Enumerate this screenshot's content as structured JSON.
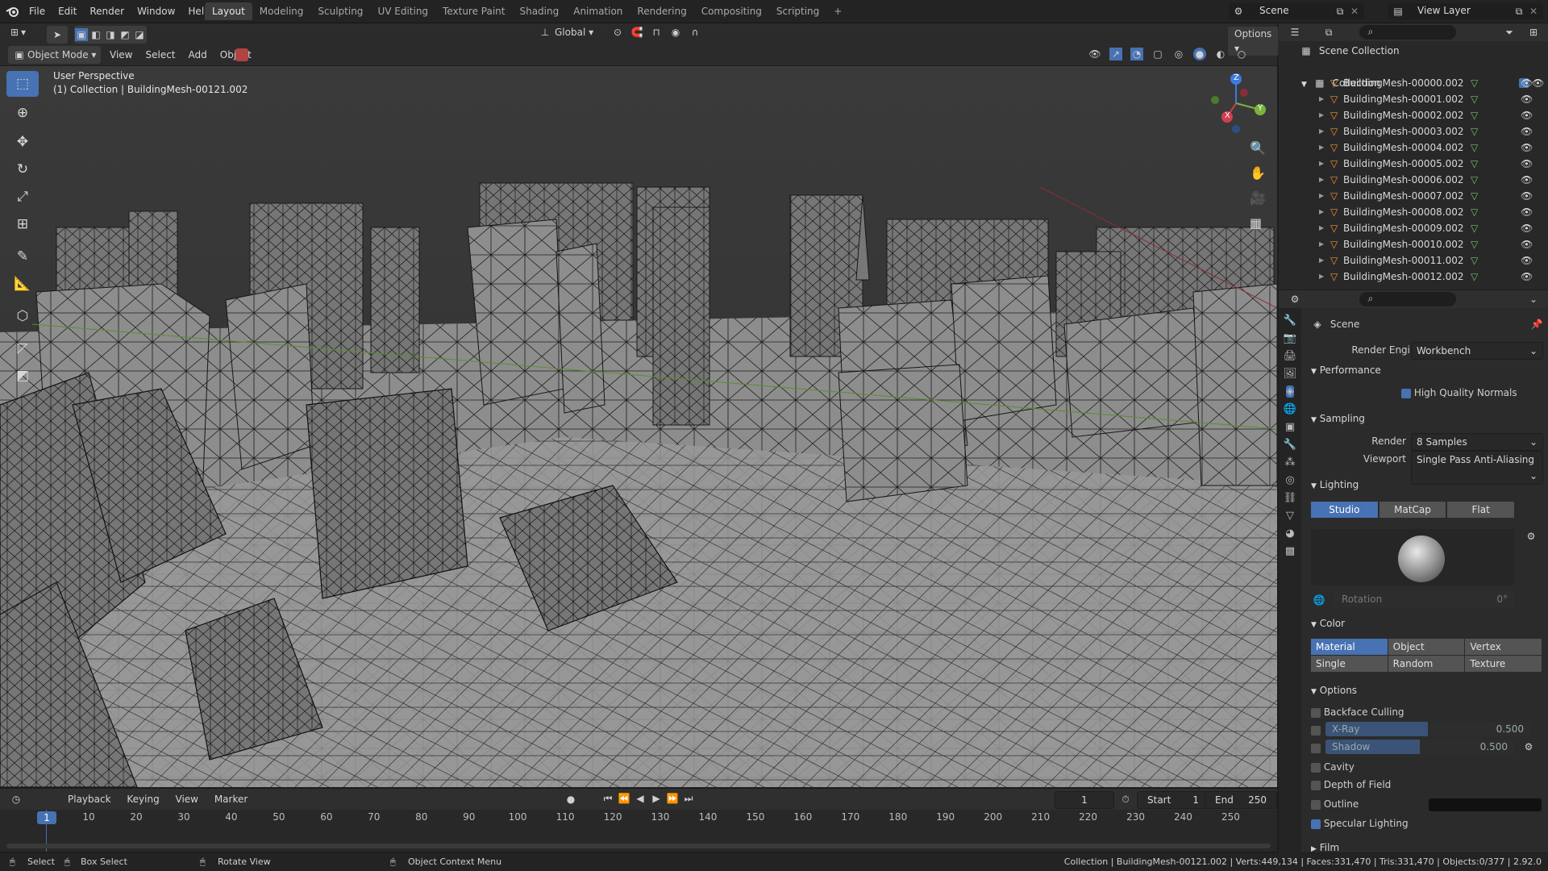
{
  "topbar": {
    "menus": [
      "File",
      "Edit",
      "Render",
      "Window",
      "Help"
    ],
    "workspaces": [
      "Layout",
      "Modeling",
      "Sculpting",
      "UV Editing",
      "Texture Paint",
      "Shading",
      "Animation",
      "Rendering",
      "Compositing",
      "Scripting"
    ],
    "active_workspace": "Layout",
    "scene": "Scene",
    "view_layer": "View Layer"
  },
  "viewport_header": {
    "mode": "Object Mode",
    "menus": [
      "View",
      "Select",
      "Add",
      "Object"
    ],
    "orientation": "Global",
    "options": "Options"
  },
  "viewport": {
    "perspective_label": "User Perspective",
    "collection_label": "(1) Collection | BuildingMesh-00121.002",
    "gizmo": {
      "x": "X",
      "y": "Y",
      "z": "Z"
    }
  },
  "outliner": {
    "root": "Scene Collection",
    "collection": "Collection",
    "items": [
      "BuildingMesh-00000.002",
      "BuildingMesh-00001.002",
      "BuildingMesh-00002.002",
      "BuildingMesh-00003.002",
      "BuildingMesh-00004.002",
      "BuildingMesh-00005.002",
      "BuildingMesh-00006.002",
      "BuildingMesh-00007.002",
      "BuildingMesh-00008.002",
      "BuildingMesh-00009.002",
      "BuildingMesh-00010.002",
      "BuildingMesh-00011.002",
      "BuildingMesh-00012.002"
    ]
  },
  "properties": {
    "context": "Scene",
    "render_engine_label": "Render Engine",
    "render_engine": "Workbench",
    "performance": {
      "title": "Performance",
      "high_quality_normals": "High Quality Normals"
    },
    "sampling": {
      "title": "Sampling",
      "render_label": "Render",
      "render_value": "8 Samples",
      "viewport_label": "Viewport",
      "viewport_value": "Single Pass Anti-Aliasing"
    },
    "lighting": {
      "title": "Lighting",
      "modes": [
        "Studio",
        "MatCap",
        "Flat"
      ],
      "active": "Studio",
      "rotation_label": "Rotation",
      "rotation_value": "0°"
    },
    "color": {
      "title": "Color",
      "options": [
        "Material",
        "Object",
        "Vertex",
        "Single",
        "Random",
        "Texture"
      ],
      "active": "Material"
    },
    "options": {
      "title": "Options",
      "backface_culling": "Backface Culling",
      "xray_label": "X-Ray",
      "xray_value": "0.500",
      "xray_fraction": 0.5,
      "shadow_label": "Shadow",
      "shadow_value": "0.500",
      "shadow_fraction": 0.5,
      "cavity": "Cavity",
      "depth_of_field": "Depth of Field",
      "outline": "Outline",
      "specular_lighting": "Specular Lighting"
    },
    "film": {
      "title": "Film"
    }
  },
  "timeline": {
    "menus": [
      "Playback",
      "Keying",
      "View",
      "Marker"
    ],
    "current_frame": "1",
    "start_label": "Start",
    "start_value": "1",
    "end_label": "End",
    "end_value": "250",
    "ticks": [
      "1",
      "10",
      "20",
      "30",
      "40",
      "50",
      "60",
      "70",
      "80",
      "90",
      "100",
      "110",
      "120",
      "130",
      "140",
      "150",
      "160",
      "170",
      "180",
      "190",
      "200",
      "210",
      "220",
      "230",
      "240",
      "250"
    ]
  },
  "statusbar": {
    "select": "Select",
    "box_select": "Box Select",
    "rotate_view": "Rotate View",
    "context_menu": "Object Context Menu",
    "info": "Collection | BuildingMesh-00121.002 | Verts:449,134 | Faces:331,470 | Tris:331,470 | Objects:0/377 | 2.92.0"
  },
  "colors": {
    "accent": "#4772b3",
    "bg": "#1d1d1d",
    "panel": "#2f2f2f",
    "viewport_grid": "#3a3a3a",
    "mesh_face": "#8a8a8a"
  }
}
